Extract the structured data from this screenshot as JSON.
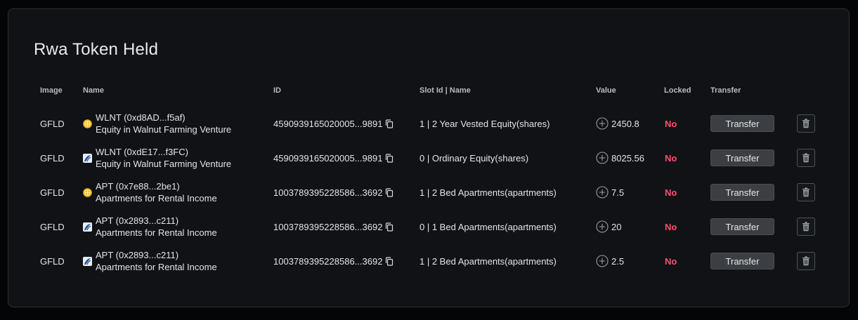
{
  "page": {
    "title": "Rwa Token Held"
  },
  "table": {
    "headers": {
      "image": "Image",
      "name": "Name",
      "id": "ID",
      "slot": "Slot Id | Name",
      "value": "Value",
      "locked": "Locked",
      "transfer": "Transfer"
    },
    "rows": [
      {
        "image": "GFLD",
        "token_icon": "gold-coin-icon",
        "name_line1": "WLNT (0xd8AD...f5af)",
        "name_line2": "Equity in Walnut Farming Venture",
        "id": "4590939165020005...9891",
        "slot": "1 | 2 Year Vested Equity(shares)",
        "value": "2450.8",
        "locked": "No",
        "transfer_label": "Transfer"
      },
      {
        "image": "GFLD",
        "token_icon": "blue-logo-icon",
        "name_line1": "WLNT (0xdE17...f3FC)",
        "name_line2": "Equity in Walnut Farming Venture",
        "id": "4590939165020005...9891",
        "slot": "0 | Ordinary Equity(shares)",
        "value": "8025.56",
        "locked": "No",
        "transfer_label": "Transfer"
      },
      {
        "image": "GFLD",
        "token_icon": "gold-coin-icon",
        "name_line1": "APT (0x7e88...2be1)",
        "name_line2": "Apartments for Rental Income",
        "id": "1003789395228586...3692",
        "slot": "1 | 2 Bed Apartments(apartments)",
        "value": "7.5",
        "locked": "No",
        "transfer_label": "Transfer"
      },
      {
        "image": "GFLD",
        "token_icon": "blue-logo-icon",
        "name_line1": "APT (0x2893...c211)",
        "name_line2": "Apartments for Rental Income",
        "id": "1003789395228586...3692",
        "slot": "0 | 1 Bed Apartments(apartments)",
        "value": "20",
        "locked": "No",
        "transfer_label": "Transfer"
      },
      {
        "image": "GFLD",
        "token_icon": "blue-logo-icon",
        "name_line1": "APT (0x2893...c211)",
        "name_line2": "Apartments for Rental Income",
        "id": "1003789395228586...3692",
        "slot": "1 | 2 Bed Apartments(apartments)",
        "value": "2.5",
        "locked": "No",
        "transfer_label": "Transfer"
      }
    ]
  },
  "colors": {
    "background": "#040506",
    "card": "#101215",
    "locked_no": "#ff4f6e",
    "button": "#3b3e42"
  }
}
